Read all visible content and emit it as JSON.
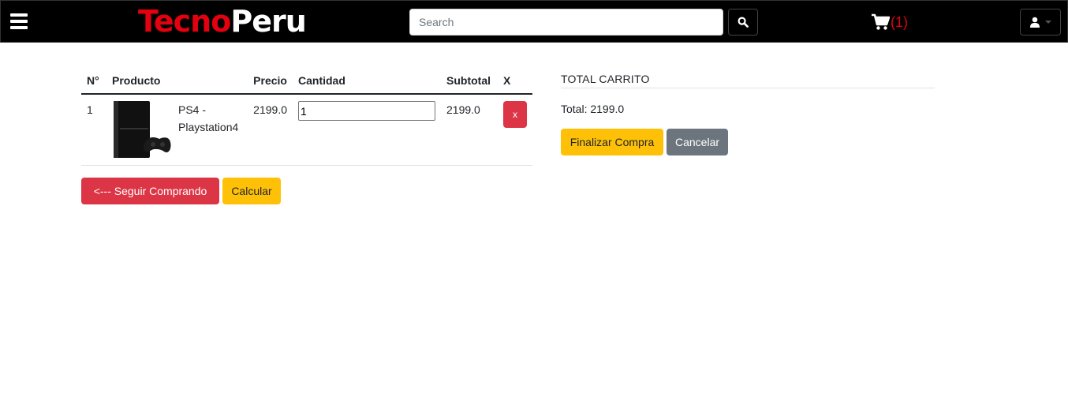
{
  "navbar": {
    "brand_part1": "Tecno",
    "brand_part2": "Peru",
    "search_placeholder": "Search",
    "cart_count": "(1)",
    "colors": {
      "background": "#000000",
      "brand_red": "#e3000f"
    }
  },
  "cart_table": {
    "headers": {
      "num": "N°",
      "product": "Producto",
      "price": "Precio",
      "quantity": "Cantidad",
      "subtotal": "Subtotal",
      "remove": "X"
    },
    "rows": [
      {
        "num": "1",
        "name": "PS4 - Playstation4",
        "price": "2199.0",
        "quantity": "1",
        "subtotal": "2199.0",
        "remove_label": "x"
      }
    ]
  },
  "actions": {
    "continue_label": "<--- Seguir Comprando",
    "calculate_label": "Calcular"
  },
  "summary": {
    "title": "TOTAL CARRITO",
    "total_text": "Total: 2199.0",
    "checkout_label": "Finalizar Compra",
    "cancel_label": "Cancelar"
  }
}
